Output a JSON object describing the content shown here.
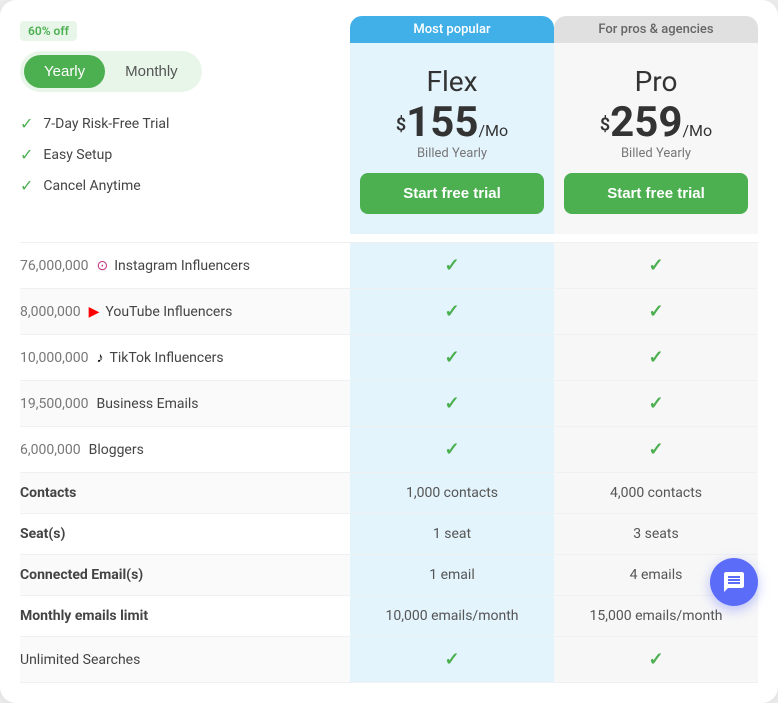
{
  "badge": {
    "discount": "60% off"
  },
  "toggle": {
    "yearly_label": "Yearly",
    "monthly_label": "Monthly",
    "active": "yearly"
  },
  "plans": {
    "flex": {
      "popular_label": "Most popular",
      "name": "Flex",
      "dollar": "$",
      "price": "155",
      "period": "/Mo",
      "billed": "Billed Yearly",
      "cta": "Start free trial"
    },
    "pro": {
      "for_label": "For pros & agencies",
      "name": "Pro",
      "dollar": "$",
      "price": "259",
      "period": "/Mo",
      "billed": "Billed Yearly",
      "cta": "Start free trial"
    }
  },
  "features": [
    {
      "label": "7-Day Risk-Free Trial"
    },
    {
      "label": "Easy Setup"
    },
    {
      "label": "Cancel Anytime"
    }
  ],
  "table_rows": [
    {
      "count": "76,000,000",
      "platform_icon": "ig",
      "platform_label": "Instagram Influencers",
      "flex": "check",
      "pro": "check"
    },
    {
      "count": "8,000,000",
      "platform_icon": "yt",
      "platform_label": "YouTube Influencers",
      "flex": "check",
      "pro": "check"
    },
    {
      "count": "10,000,000",
      "platform_icon": "tt",
      "platform_label": "TikTok Influencers",
      "flex": "check",
      "pro": "check"
    },
    {
      "count": "19,500,000",
      "platform_icon": "",
      "platform_label": "Business Emails",
      "flex": "check",
      "pro": "check"
    },
    {
      "count": "6,000,000",
      "platform_icon": "",
      "platform_label": "Bloggers",
      "flex": "check",
      "pro": "check"
    },
    {
      "label": "Contacts",
      "bold": true,
      "flex": "1,000 contacts",
      "pro": "4,000 contacts"
    },
    {
      "label": "Seat(s)",
      "bold": true,
      "flex": "1 seat",
      "pro": "3 seats"
    },
    {
      "label": "Connected Email(s)",
      "bold": true,
      "flex": "1 email",
      "pro": "4 emails"
    },
    {
      "label": "Monthly emails limit",
      "bold": true,
      "flex": "10,000 emails/month",
      "pro": "15,000 emails/month"
    },
    {
      "label": "Unlimited Searches",
      "bold": false,
      "flex": "check",
      "pro": "check"
    }
  ],
  "chat_button": {
    "label": "chat"
  }
}
